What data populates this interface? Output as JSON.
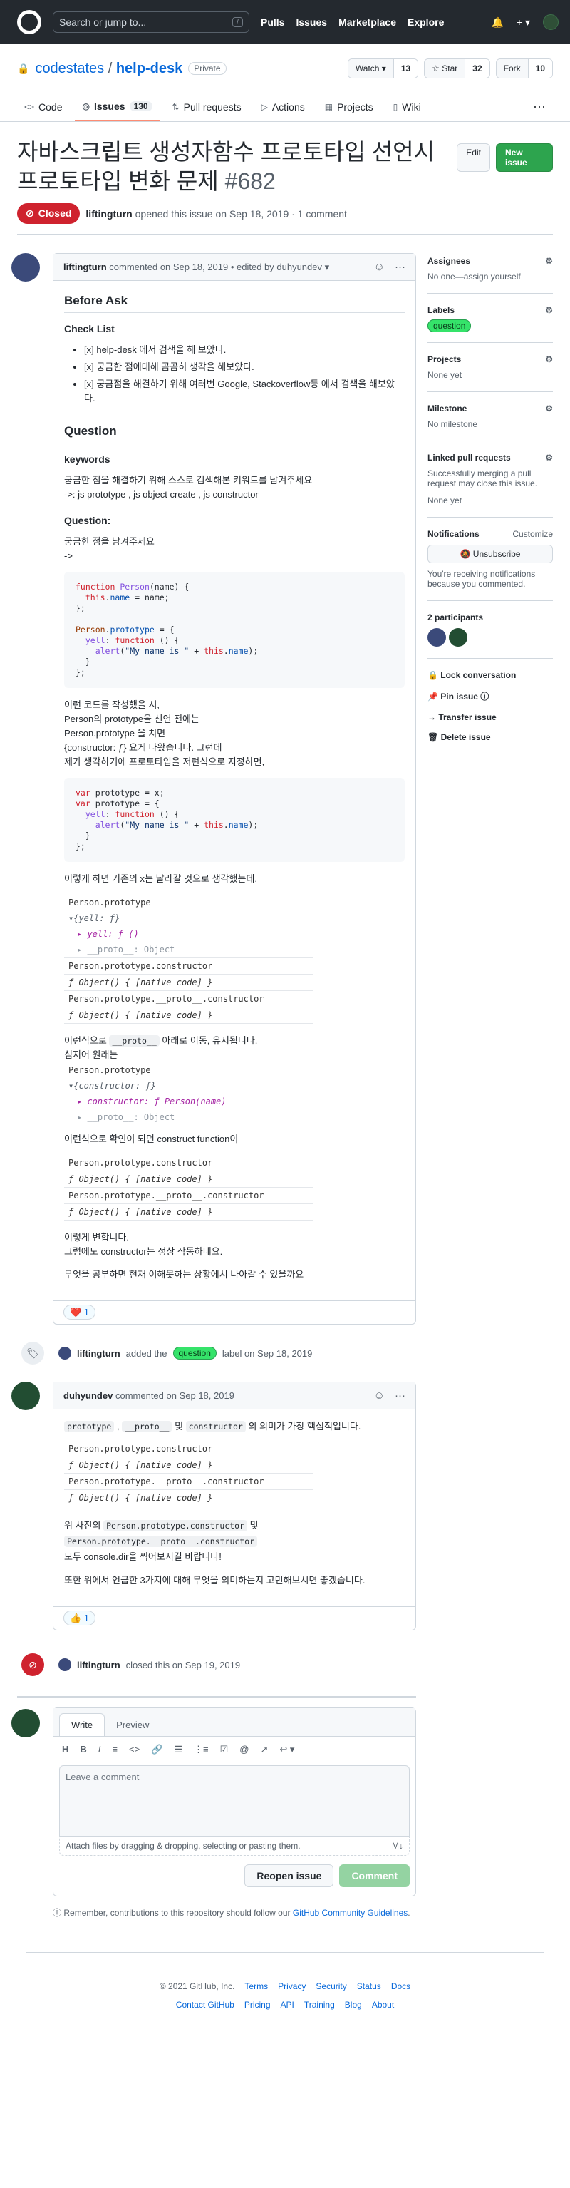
{
  "header": {
    "search_placeholder": "Search or jump to...",
    "slash": "/",
    "nav": [
      "Pulls",
      "Issues",
      "Marketplace",
      "Explore"
    ],
    "plus": "+ ▾",
    "bell": "🔔"
  },
  "repo": {
    "owner": "codestates",
    "sep": " / ",
    "name": "help-desk",
    "visibility": "Private",
    "watch": "Watch ▾",
    "watch_count": "13",
    "star": "☆ Star",
    "star_count": "32",
    "fork": "Fork",
    "fork_count": "10"
  },
  "tabs": [
    {
      "icon": "<>",
      "label": "Code"
    },
    {
      "icon": "◎",
      "label": "Issues",
      "count": "130"
    },
    {
      "icon": "⇅",
      "label": "Pull requests"
    },
    {
      "icon": "▷",
      "label": "Actions"
    },
    {
      "icon": "▦",
      "label": "Projects"
    },
    {
      "icon": "▯",
      "label": "Wiki"
    }
  ],
  "issue": {
    "title": "자바스크립트 생성자함수 프로토타입 선언시 프로토타입 변화 문제",
    "number": "#682",
    "edit": "Edit",
    "new_issue": "New issue",
    "state": "Closed",
    "author": "liftingturn",
    "meta_rest": "opened this issue on Sep 18, 2019 · 1 comment"
  },
  "comment1": {
    "author": "liftingturn",
    "meta": "commented on Sep 18, 2019 • edited by duhyundev ▾",
    "h_before": "Before Ask",
    "h_check": "Check List",
    "checks": [
      "[x] help-desk 에서 검색을 해 보았다.",
      "[x] 궁금한 점에대해 곰곰히 생각을 해보았다.",
      "[x] 궁금점을 해결하기 위해 여러번 Google, Stackoverflow등 에서 검색을 해보았다."
    ],
    "h_question": "Question",
    "h_keywords": "keywords",
    "kw1": "궁금한 점을 해결하기 위해 스스로 검색해본 키워드를 남겨주세요",
    "kw2": "->: js prototype , js object create , js constructor",
    "h_q2": "Question:",
    "q1": "궁금한 점을 남겨주세요",
    "q2": "->",
    "p1": [
      "이런 코드를 작성했을 시,",
      "Person의 prototype을 선언 전에는",
      "Person.prototype 을 치면",
      "{constructor: ƒ} 요게 나왔습니다. 그런데",
      "제가 생각하기에 프로토타입을 저런식으로 지정하면,"
    ],
    "p2": "이렇게 하면 기존의 x는 날라갈 것으로 생각했는데,",
    "c1": [
      "Person.prototype",
      "▾{yell: ƒ}",
      "▸ yell: ƒ ()",
      "▸ __proto__: Object",
      "Person.prototype.constructor",
      "ƒ Object() { [native code] }",
      "Person.prototype.__proto__.constructor",
      "ƒ Object() { [native code] }"
    ],
    "p3a": "이런식으로",
    "p3code": "__proto__",
    "p3b": "아래로 이동, 유지됩니다.",
    "p4": "심지어 원래는",
    "c2": [
      "Person.prototype",
      "▾{constructor: ƒ}",
      "▸ constructor: ƒ Person(name)",
      "▸ __proto__: Object"
    ],
    "p5": "이런식으로 확인이 되던 construct function이",
    "c3": [
      "Person.prototype.constructor",
      "ƒ Object() { [native code] }",
      "Person.prototype.__proto__.constructor",
      "ƒ Object() { [native code] }"
    ],
    "p6": [
      "이렇게 변합니다.",
      "그럼에도 constructor는 정상 작동하네요."
    ],
    "p7": "무엇을 공부하면 현재 이해못하는 상황에서 나아갈 수 있을까요",
    "reaction": "❤️ 1"
  },
  "event_label": {
    "author": "liftingturn",
    "pre": "added the",
    "label": "question",
    "post": "label on Sep 18, 2019"
  },
  "comment2": {
    "author": "duhyundev",
    "meta": "commented on Sep 18, 2019",
    "line1_code1": "prototype",
    "line1_sep1": " , ",
    "line1_code2": "__proto__",
    "line1_sep2": " 및 ",
    "line1_code3": "constructor",
    "line1_rest": " 의 의미가 가장 핵심적입니다.",
    "c1": [
      "Person.prototype.constructor",
      "ƒ Object() { [native code] }",
      "Person.prototype.__proto__.constructor",
      "ƒ Object() { [native code] }"
    ],
    "p2a": "위 사진의",
    "p2code1": "Person.prototype.constructor",
    "p2b": "및",
    "p2code2": "Person.prototype.__proto__.constructor",
    "p3": "모두 console.dir을 찍어보시길 바랍니다!",
    "p4": "또한 위에서 언급한 3가지에 대해 무엇을 의미하는지 고민해보시면 좋겠습니다.",
    "reaction": "👍 1"
  },
  "event_closed": {
    "author": "liftingturn",
    "text": "closed this on Sep 19, 2019"
  },
  "editor": {
    "tab_write": "Write",
    "tab_preview": "Preview",
    "tools": [
      "H",
      "B",
      "I",
      "≡",
      "<>",
      "🔗",
      "☰",
      "⋮≡",
      "☑",
      "@",
      "↗",
      "↩ ▾"
    ],
    "placeholder": "Leave a comment",
    "attach": "Attach files by dragging & dropping, selecting or pasting them.",
    "md": "M↓",
    "reopen": "Reopen issue",
    "comment": "Comment"
  },
  "note": {
    "text": "Remember, contributions to this repository should follow our",
    "link": "GitHub Community Guidelines",
    "end": "."
  },
  "sidebar": {
    "assignees": "Assignees",
    "assignees_val": "No one—assign yourself",
    "labels": "Labels",
    "labels_val": "question",
    "projects": "Projects",
    "projects_val": "None yet",
    "milestone": "Milestone",
    "milestone_val": "No milestone",
    "linked": "Linked pull requests",
    "linked_desc": "Successfully merging a pull request may close this issue.",
    "linked_val": "None yet",
    "notifications": "Notifications",
    "customize": "Customize",
    "unsubscribe": "🔕 Unsubscribe",
    "notif_desc": "You're receiving notifications because you commented.",
    "participants": "2 participants",
    "lock": "🔒 Lock conversation",
    "pin": "📌 Pin issue ⓘ",
    "transfer": "→ Transfer issue",
    "delete": "🗑 Delete issue"
  },
  "footer": {
    "row1": [
      "© 2021 GitHub, Inc.",
      "Terms",
      "Privacy",
      "Security",
      "Status",
      "Docs"
    ],
    "row2": [
      "Contact GitHub",
      "Pricing",
      "API",
      "Training",
      "Blog",
      "About"
    ]
  },
  "colors": {
    "header_bg": "#24292f",
    "closed": "#cf222e",
    "green": "#2da44e",
    "link": "#0969da",
    "label": "#35e36a"
  }
}
